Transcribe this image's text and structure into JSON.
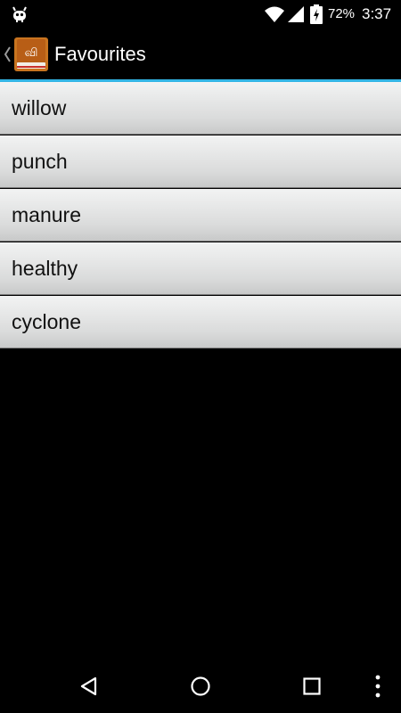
{
  "status_bar": {
    "battery_percent": "72%",
    "time": "3:37",
    "icons": [
      "debug-icon",
      "wifi-icon",
      "signal-icon",
      "battery-charging-icon"
    ]
  },
  "action_bar": {
    "title": "Favourites",
    "app_icon": "dictionary-book-icon",
    "app_icon_glyph": "வி",
    "accent_color": "#33b5e5"
  },
  "favourites": {
    "items": [
      {
        "label": "willow"
      },
      {
        "label": "punch"
      },
      {
        "label": "manure"
      },
      {
        "label": "healthy"
      },
      {
        "label": "cyclone"
      }
    ]
  },
  "nav_bar": {
    "buttons": [
      "back-icon",
      "home-icon",
      "recents-icon",
      "overflow-menu-icon"
    ]
  }
}
